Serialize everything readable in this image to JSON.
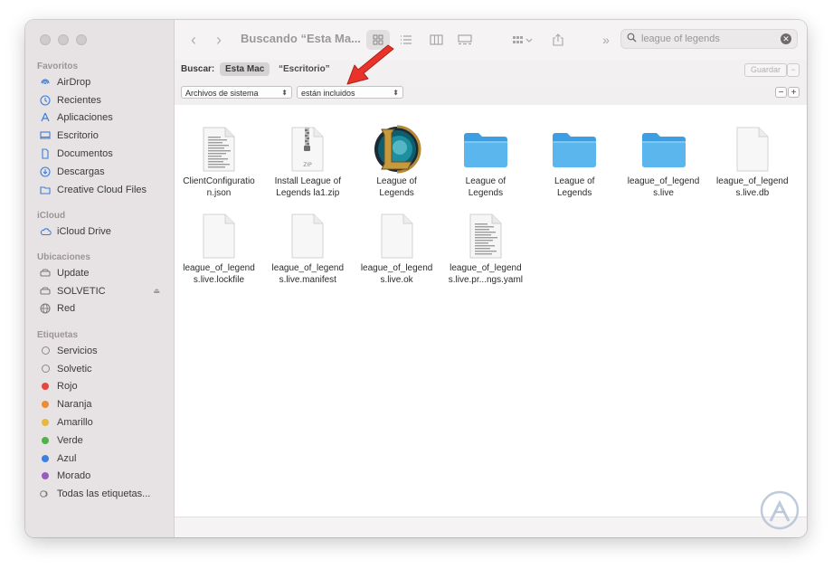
{
  "window": {
    "title": "Buscando “Esta Ma...",
    "traffic_lights": [
      "close",
      "minimize",
      "zoom"
    ]
  },
  "sidebar": {
    "sections": [
      {
        "heading": "Favoritos",
        "items": [
          {
            "label": "AirDrop",
            "icon": "airdrop-icon"
          },
          {
            "label": "Recientes",
            "icon": "clock-icon"
          },
          {
            "label": "Aplicaciones",
            "icon": "apps-icon"
          },
          {
            "label": "Escritorio",
            "icon": "desktop-icon"
          },
          {
            "label": "Documentos",
            "icon": "document-icon"
          },
          {
            "label": "Descargas",
            "icon": "download-icon"
          },
          {
            "label": "Creative Cloud Files",
            "icon": "folder-icon"
          }
        ]
      },
      {
        "heading": "iCloud",
        "items": [
          {
            "label": "iCloud Drive",
            "icon": "cloud-icon"
          }
        ]
      },
      {
        "heading": "Ubicaciones",
        "items": [
          {
            "label": "Update",
            "icon": "disk-icon"
          },
          {
            "label": "SOLVETIC",
            "icon": "disk-icon",
            "eject": true
          },
          {
            "label": "Red",
            "icon": "globe-icon"
          }
        ]
      },
      {
        "heading": "Etiquetas",
        "items": [
          {
            "label": "Servicios",
            "tag": "ring"
          },
          {
            "label": "Solvetic",
            "tag": "ring"
          },
          {
            "label": "Rojo",
            "tag": "#e5483b"
          },
          {
            "label": "Naranja",
            "tag": "#ef8b32"
          },
          {
            "label": "Amarillo",
            "tag": "#e6b83b"
          },
          {
            "label": "Verde",
            "tag": "#4db34a"
          },
          {
            "label": "Azul",
            "tag": "#3a82e0"
          },
          {
            "label": "Morado",
            "tag": "#9b5cc2"
          },
          {
            "label": "Todas las etiquetas...",
            "tag": "all"
          }
        ]
      }
    ]
  },
  "search": {
    "value": "league of legends"
  },
  "scope": {
    "label": "Buscar:",
    "options": [
      "Esta Mac",
      "“Escritorio”"
    ],
    "selected": "Esta Mac",
    "save_label": "Guardar"
  },
  "criteria": {
    "attribute": "Archivos de sistema",
    "operator": "están incluidos"
  },
  "files": [
    {
      "name": "ClientConfiguration.json",
      "name_lines": [
        "ClientConfiguratio",
        "n.json"
      ],
      "kind": "text-doc"
    },
    {
      "name": "Install League of Legends la1.zip",
      "name_lines": [
        "Install League of",
        "Legends la1.zip"
      ],
      "kind": "zip",
      "badge": "ZIP"
    },
    {
      "name": "League of Legends",
      "name_lines": [
        "League of",
        "Legends"
      ],
      "kind": "lol-app"
    },
    {
      "name": "League of Legends",
      "name_lines": [
        "League of",
        "Legends"
      ],
      "kind": "folder"
    },
    {
      "name": "League of Legends",
      "name_lines": [
        "League of",
        "Legends"
      ],
      "kind": "folder"
    },
    {
      "name": "league_of_legends.live",
      "name_lines": [
        "league_of_legend",
        "s.live"
      ],
      "kind": "folder"
    },
    {
      "name": "league_of_legends.live.db",
      "name_lines": [
        "league_of_legend",
        "s.live.db"
      ],
      "kind": "blank-doc"
    },
    {
      "name": "league_of_legends.live.lockfile",
      "name_lines": [
        "league_of_legend",
        "s.live.lockfile"
      ],
      "kind": "blank-doc"
    },
    {
      "name": "league_of_legends.live.manifest",
      "name_lines": [
        "league_of_legend",
        "s.live.manifest"
      ],
      "kind": "blank-doc"
    },
    {
      "name": "league_of_legends.live.ok",
      "name_lines": [
        "league_of_legend",
        "s.live.ok"
      ],
      "kind": "blank-doc"
    },
    {
      "name": "league_of_legends.live.pr...ngs.yaml",
      "name_lines": [
        "league_of_legend",
        "s.live.pr...ngs.yaml"
      ],
      "kind": "text-doc"
    }
  ],
  "colors": {
    "annotation_arrow": "#e8332a",
    "folder": "#5bb6ee",
    "accent": "#3c7dd8"
  }
}
